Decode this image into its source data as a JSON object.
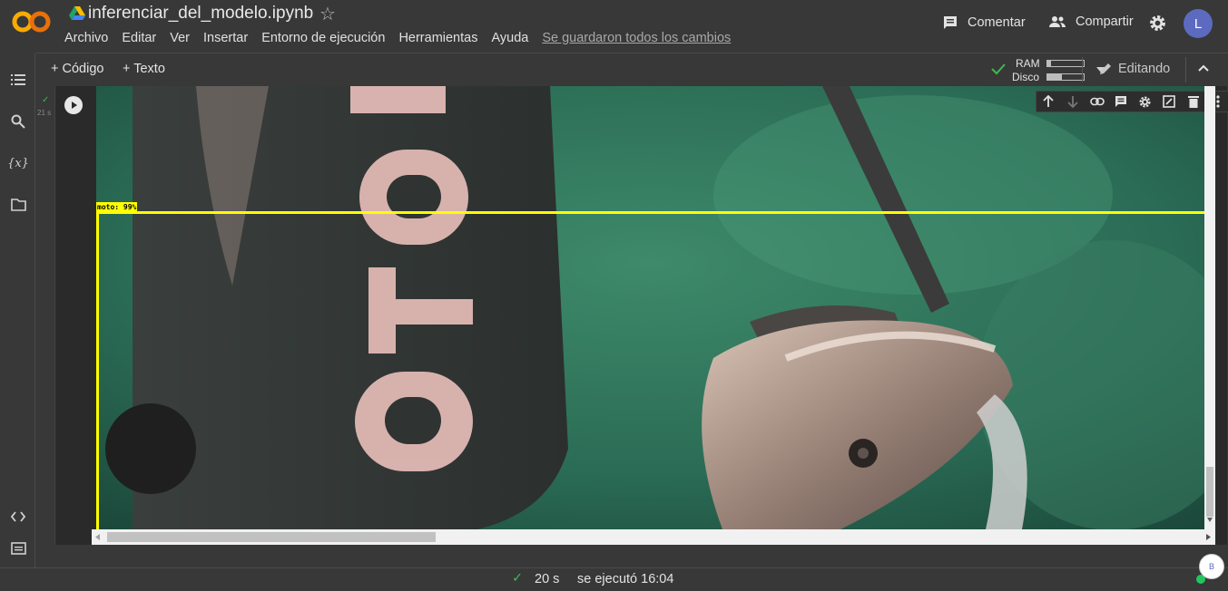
{
  "header": {
    "title": "inferenciar_del_modelo.ipynb",
    "menu": [
      "Archivo",
      "Editar",
      "Ver",
      "Insertar",
      "Entorno de ejecución",
      "Herramientas",
      "Ayuda"
    ],
    "saved_status": "Se guardaron todos los cambios",
    "comment_label": "Comentar",
    "share_label": "Compartir",
    "avatar_letter": "L"
  },
  "toolbar": {
    "add_code": "Código",
    "add_text": "Texto",
    "ram_label": "RAM",
    "disk_label": "Disco",
    "ram_usage": 0.1,
    "disk_usage": 0.4,
    "mode_label": "Editando"
  },
  "cell": {
    "exec_time": "21 s",
    "detection_label": "moto: 99%",
    "photo_text": "MOTO"
  },
  "status": {
    "duration": "20 s",
    "executed_at": "se ejecutó 16:04",
    "bubble_letter": "B"
  },
  "colors": {
    "accent_orange": "#f9ab00",
    "detection_box": "#ffff00",
    "success": "#3fb950"
  }
}
